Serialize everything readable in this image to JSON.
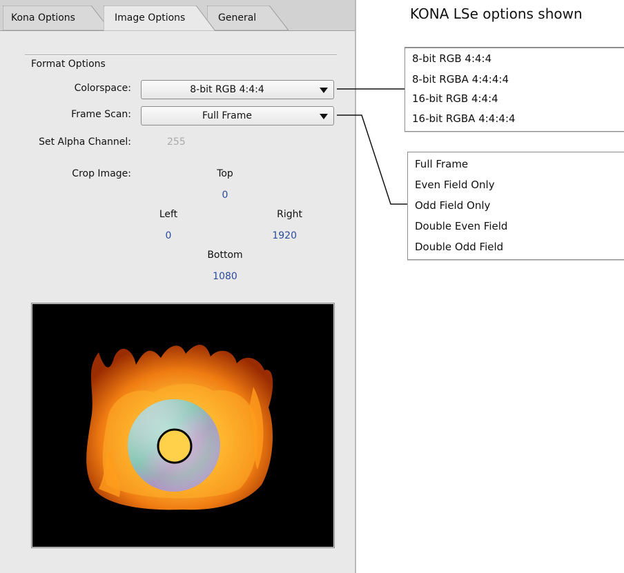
{
  "tabs": [
    {
      "label": "Kona Options",
      "active": false
    },
    {
      "label": "Image Options",
      "active": true
    },
    {
      "label": "General",
      "active": false
    }
  ],
  "format_options": {
    "group_label": "Format Options",
    "colorspace_label": "Colorspace:",
    "colorspace_value": "8-bit RGB 4:4:4",
    "frame_scan_label": "Frame Scan:",
    "frame_scan_value": "Full Frame",
    "alpha_label": "Set Alpha Channel:",
    "alpha_value": "255"
  },
  "crop": {
    "label": "Crop Image:",
    "top_label": "Top",
    "top_value": "0",
    "left_label": "Left",
    "left_value": "0",
    "right_label": "Right",
    "right_value": "1920",
    "bottom_label": "Bottom",
    "bottom_value": "1080"
  },
  "annotation": {
    "title": "KONA LSe options shown",
    "colorspace_options": [
      "8-bit RGB 4:4:4",
      "8-bit RGBA 4:4:4:4",
      "16-bit RGB 4:4:4",
      "16-bit RGBA 4:4:4:4"
    ],
    "frame_scan_options": [
      "Full Frame",
      "Even Field Only",
      "Odd Field Only",
      "Double Even Field",
      "Double Odd Field"
    ]
  },
  "colors": {
    "panel_bg": "#e9e9e9",
    "tab_strip_bg": "#d2d2d2",
    "value_blue": "#2a4a9c",
    "disabled_gray": "#a9a9a9"
  }
}
